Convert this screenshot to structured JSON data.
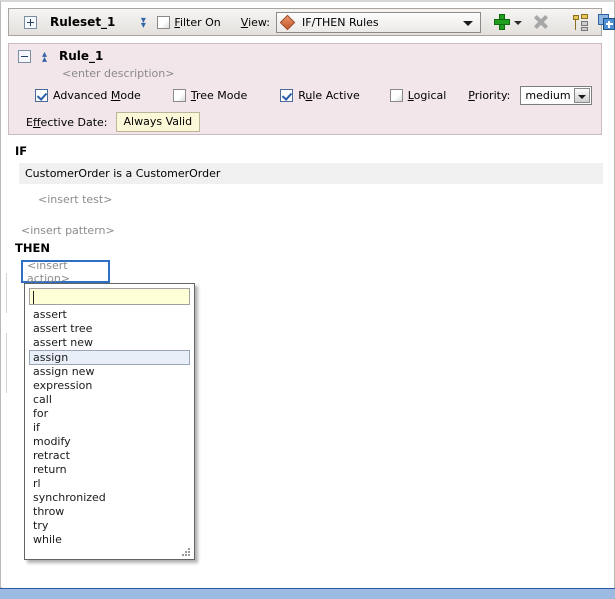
{
  "toolbar": {
    "expand_icon": "plus-box-icon",
    "ruleset_name": "Ruleset_1",
    "double_chevron_icon": "double-chevron-down-icon",
    "filter_on_label": "Filter On",
    "filter_on_checked": false,
    "view_label": "View:",
    "view_value": "IF/THEN Rules",
    "view_icon": "orange-diamond-icon",
    "add_icon": "green-plus-icon",
    "add_dropdown_icon": "caret-down-icon",
    "delete_icon": "gray-x-icon",
    "tree_icon": "rule-tree-icon",
    "expand_all_icon": "expand-all-blue-icon",
    "collapse_all_icon": "collapse-all-blue-icon",
    "glasses_icon": "glasses-icon",
    "move_up_icon": "chevron-up-icon",
    "move_down_icon": "chevron-down-icon"
  },
  "rule": {
    "collapse_icon": "minus-box-icon",
    "chevron_icon": "double-chevron-up-icon",
    "title": "Rule_1",
    "description": "<enter description>",
    "options": [
      {
        "label": "Advanced Mode",
        "checked": true,
        "accesskey": "M"
      },
      {
        "label": "Tree Mode",
        "checked": false,
        "accesskey": "T"
      },
      {
        "label": "Rule Active",
        "checked": true,
        "accesskey": "u"
      },
      {
        "label": "Logical",
        "checked": false,
        "accesskey": "L"
      }
    ],
    "priority_label": "Priority:",
    "priority_value": "medium",
    "effective_date_label": "Effective Date:",
    "effective_date_value": "Always Valid"
  },
  "body": {
    "if_keyword": "IF",
    "pattern_text": "CustomerOrder is a CustomerOrder",
    "insert_test": "<insert test>",
    "insert_pattern": "<insert pattern>",
    "then_keyword": "THEN",
    "insert_action": "<insert action>"
  },
  "popup": {
    "search_value": "",
    "items": [
      "assert",
      "assert tree",
      "assert new",
      "assign",
      "assign new",
      "expression",
      "call",
      "for",
      "if",
      "modify",
      "retract",
      "return",
      "rl",
      "synchronized",
      "throw",
      "try",
      "while"
    ],
    "selected_index": 3,
    "resize_grip_icon": "resize-grip-icon"
  },
  "colors": {
    "rule_panel_bg": "#f2e6ea",
    "accent_blue": "#2f6fc4",
    "selection_blue": "#e9eff9",
    "status_bar": "#9dbbe2",
    "search_yellow": "#ffffd7",
    "effective_date_yellow": "#fbf8d8",
    "diamond_orange": "#c4552a"
  }
}
